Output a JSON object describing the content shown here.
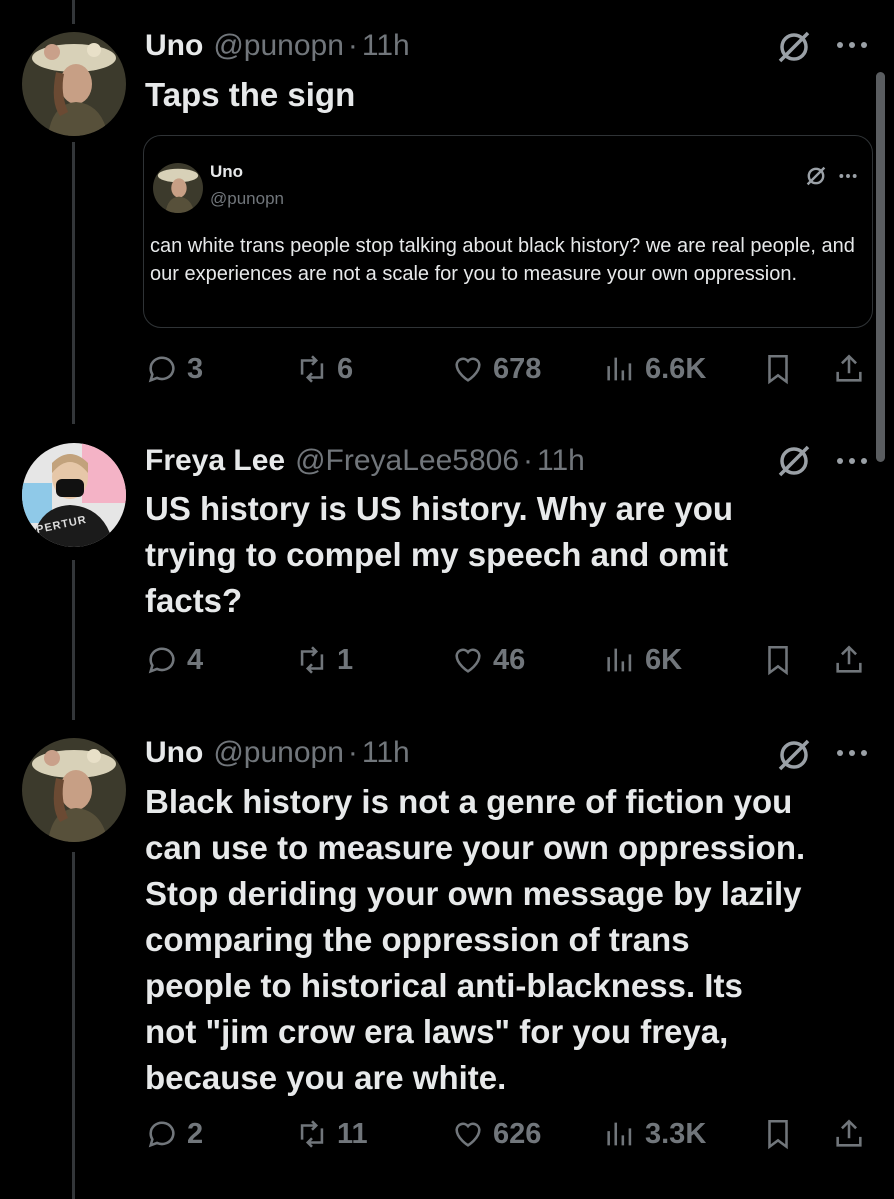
{
  "tweets": [
    {
      "name": "Uno",
      "handle": "@punopn",
      "time": "11h",
      "text": "Taps the sign",
      "quote": {
        "name": "Uno",
        "handle": "@punopn",
        "text": "can white trans people stop talking about black history? we are real people, and our experiences are not a scale for you to measure your own oppression."
      },
      "replies": "3",
      "retweets": "6",
      "likes": "678",
      "views": "6.6K"
    },
    {
      "name": "Freya Lee",
      "handle": "@FreyaLee5806",
      "time": "11h",
      "text": "US history is US history. Why are you\ntrying to compel my speech and omit\nfacts?",
      "avatar_shirt_text": "PERTUR",
      "replies": "4",
      "retweets": "1",
      "likes": "46",
      "views": "6K"
    },
    {
      "name": "Uno",
      "handle": "@punopn",
      "time": "11h",
      "text": "Black history is not a genre of fiction you\ncan use to measure your own oppression.\nStop deriding your own message by lazily\ncomparing the oppression of trans\npeople to historical anti-blackness. Its\nnot \"jim crow era laws\" for you freya,\nbecause you are white.",
      "replies": "2",
      "retweets": "11",
      "likes": "626",
      "views": "3.3K"
    }
  ],
  "separator": "·",
  "icons": [
    "reply-icon",
    "retweet-icon",
    "like-icon",
    "views-icon",
    "bookmark-icon",
    "share-icon",
    "grok-icon",
    "more-icon"
  ],
  "colors": {
    "background": "#000000",
    "text": "#e7e9ea",
    "muted": "#71767b",
    "border": "#2f3336"
  }
}
